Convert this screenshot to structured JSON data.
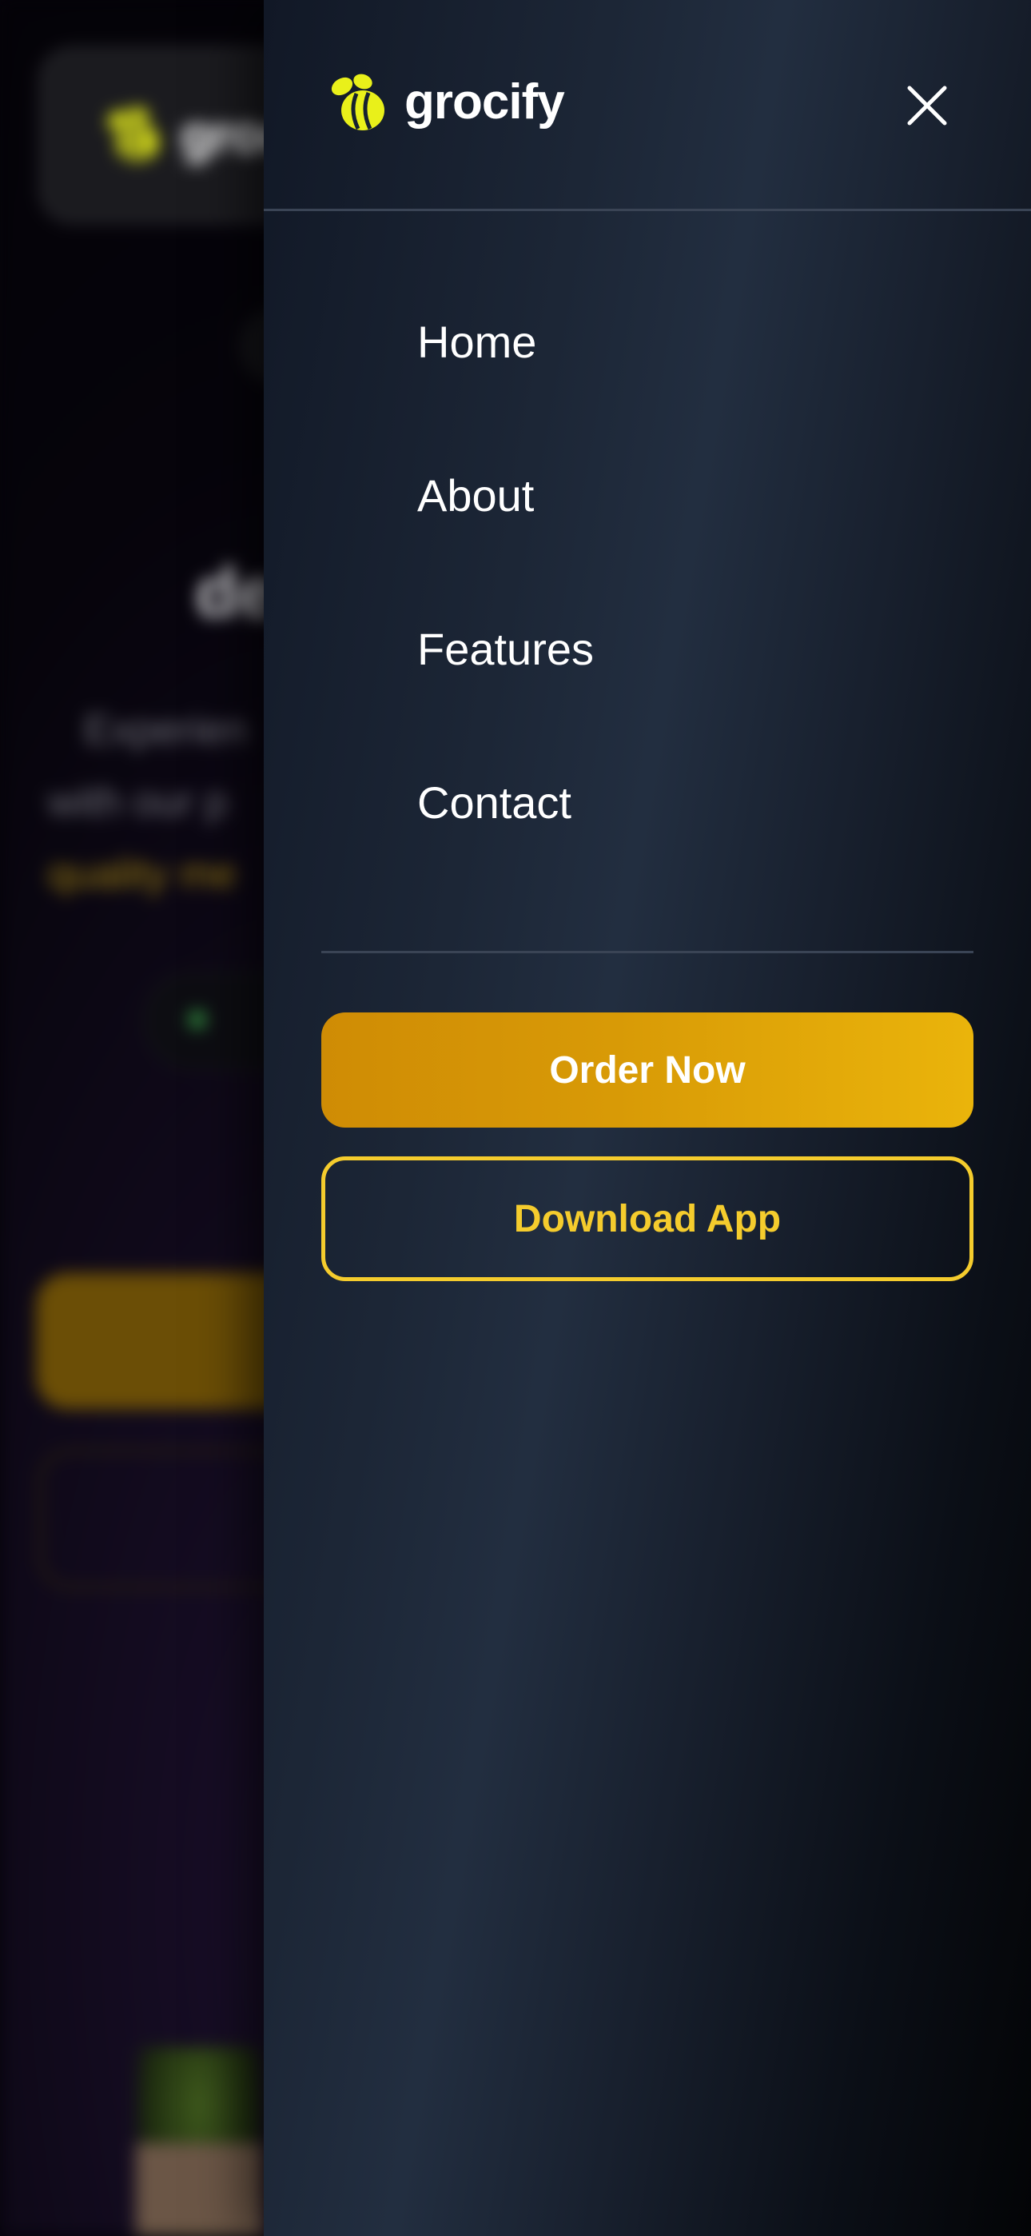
{
  "brand": {
    "name": "grocify",
    "accent_color": "#f5cc2d",
    "logo_icon": "bee-icon"
  },
  "background": {
    "header_logo_text": "groc",
    "headline": "de",
    "body_line_1": "Experien",
    "body_line_2": "with our p",
    "body_line_3": "quality me"
  },
  "drawer": {
    "close_icon": "close-icon",
    "nav_items": [
      {
        "label": "Home"
      },
      {
        "label": "About"
      },
      {
        "label": "Features"
      },
      {
        "label": "Contact"
      }
    ],
    "order_button_label": "Order Now",
    "download_button_label": "Download App",
    "order_gradient": [
      "#cf8c05",
      "#eab40b"
    ]
  }
}
